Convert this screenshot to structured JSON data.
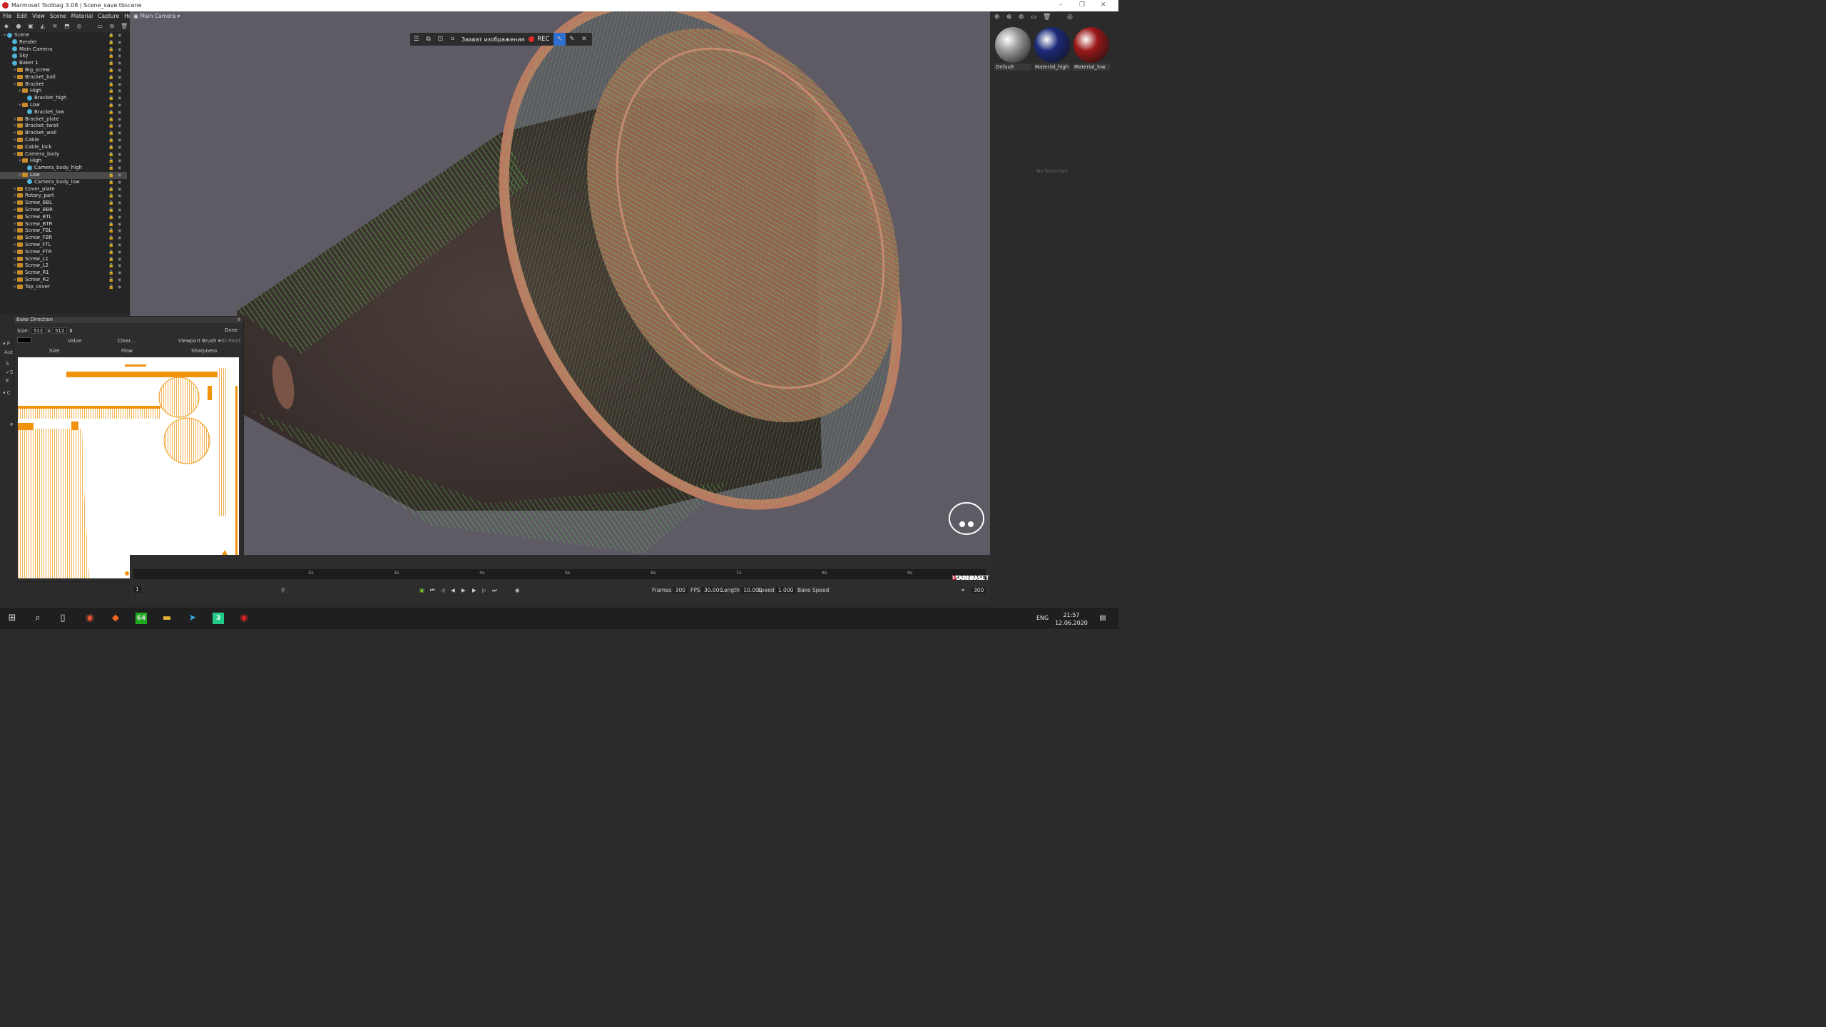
{
  "window": {
    "title": "Marmoset Toolbag 3.08  |  Scene_save.tbscene"
  },
  "menu": [
    "File",
    "Edit",
    "View",
    "Scene",
    "Material",
    "Capture",
    "Help"
  ],
  "scene_tree": [
    {
      "label": "Scene",
      "depth": 0,
      "kind": "root"
    },
    {
      "label": "Render",
      "depth": 1,
      "kind": "obj"
    },
    {
      "label": "Main Camera",
      "depth": 1,
      "kind": "obj"
    },
    {
      "label": "Sky",
      "depth": 1,
      "kind": "obj"
    },
    {
      "label": "Baker 1",
      "depth": 1,
      "kind": "obj"
    },
    {
      "label": "Big_screw",
      "depth": 2,
      "kind": "folder"
    },
    {
      "label": "Bracket_ball",
      "depth": 2,
      "kind": "folder"
    },
    {
      "label": "Bracket",
      "depth": 2,
      "kind": "folder"
    },
    {
      "label": "High",
      "depth": 3,
      "kind": "folder"
    },
    {
      "label": "Bracket_high",
      "depth": 4,
      "kind": "obj"
    },
    {
      "label": "Low",
      "depth": 3,
      "kind": "folder"
    },
    {
      "label": "Bracket_low",
      "depth": 4,
      "kind": "obj"
    },
    {
      "label": "Bracket_plate",
      "depth": 2,
      "kind": "folder"
    },
    {
      "label": "Bracket_twist",
      "depth": 2,
      "kind": "folder"
    },
    {
      "label": "Bracket_wall",
      "depth": 2,
      "kind": "folder"
    },
    {
      "label": "Cable",
      "depth": 2,
      "kind": "folder"
    },
    {
      "label": "Cable_lock",
      "depth": 2,
      "kind": "folder"
    },
    {
      "label": "Camera_body",
      "depth": 2,
      "kind": "folder"
    },
    {
      "label": "High",
      "depth": 3,
      "kind": "folder"
    },
    {
      "label": "Camera_body_high",
      "depth": 4,
      "kind": "obj"
    },
    {
      "label": "Low",
      "depth": 3,
      "kind": "folder",
      "selected": true
    },
    {
      "label": "Camera_body_low",
      "depth": 4,
      "kind": "obj"
    },
    {
      "label": "Cover_plate",
      "depth": 2,
      "kind": "folder"
    },
    {
      "label": "Rotary_part",
      "depth": 2,
      "kind": "folder"
    },
    {
      "label": "Screw_BBL",
      "depth": 2,
      "kind": "folder"
    },
    {
      "label": "Screw_BBR",
      "depth": 2,
      "kind": "folder"
    },
    {
      "label": "Screw_BTL",
      "depth": 2,
      "kind": "folder"
    },
    {
      "label": "Screw_BTR",
      "depth": 2,
      "kind": "folder"
    },
    {
      "label": "Screw_FBL",
      "depth": 2,
      "kind": "folder"
    },
    {
      "label": "Screw_FBR",
      "depth": 2,
      "kind": "folder"
    },
    {
      "label": "Screw_FTL",
      "depth": 2,
      "kind": "folder"
    },
    {
      "label": "Screw_FTR",
      "depth": 2,
      "kind": "folder"
    },
    {
      "label": "Screw_L1",
      "depth": 2,
      "kind": "folder"
    },
    {
      "label": "Screw_L2",
      "depth": 2,
      "kind": "folder"
    },
    {
      "label": "Screw_R1",
      "depth": 2,
      "kind": "folder"
    },
    {
      "label": "Screw_R2",
      "depth": 2,
      "kind": "folder"
    },
    {
      "label": "Top_cover",
      "depth": 2,
      "kind": "folder"
    }
  ],
  "viewport": {
    "camera": "Main Camera"
  },
  "capture_bar": {
    "label": "Захват изображения",
    "rec": "REC"
  },
  "bake_panel": {
    "title": "Bake Direction",
    "size_label": "Size:",
    "width": "512",
    "x": "x",
    "height": "512",
    "done": "Done",
    "value": "Value",
    "clear": "Clear...",
    "brush": "Viewport Brush",
    "paint": "3D Paint",
    "col_size": "Size",
    "col_flow": "Flow",
    "col_sharp": "Sharpness"
  },
  "left_stub": {
    "aut": "Aut",
    "p1": "P",
    "p2": "P",
    "s1": "S",
    "s2": "S",
    "e": "E",
    "c": "C"
  },
  "timeline": {
    "ticks": [
      "2s",
      "3s",
      "4s",
      "5s",
      "6s",
      "7s",
      "8s",
      "9s"
    ],
    "frame": "1",
    "frames_label": "Frames",
    "frames": "300",
    "fps_label": "FPS",
    "fps": "30.000",
    "length_label": "Length",
    "length": "10.000",
    "speed_label": "Speed",
    "speed": "1.000",
    "bake_speed": "Bake Speed",
    "end_frame": "300"
  },
  "materials": [
    {
      "name": "Default",
      "color": "#9a9a9a"
    },
    {
      "name": "Material_high",
      "color": "#1c2a7a"
    },
    {
      "name": "Material_low",
      "color": "#9a1818"
    }
  ],
  "right_panel": {
    "no_selection": "No Selection"
  },
  "logo": {
    "line1": "MARMOSET",
    "line2": "TOOLBAG",
    "version": "3"
  },
  "taskbar": {
    "lang": "ENG",
    "time": "21:57",
    "date": "12.06.2020",
    "notif": "2"
  }
}
